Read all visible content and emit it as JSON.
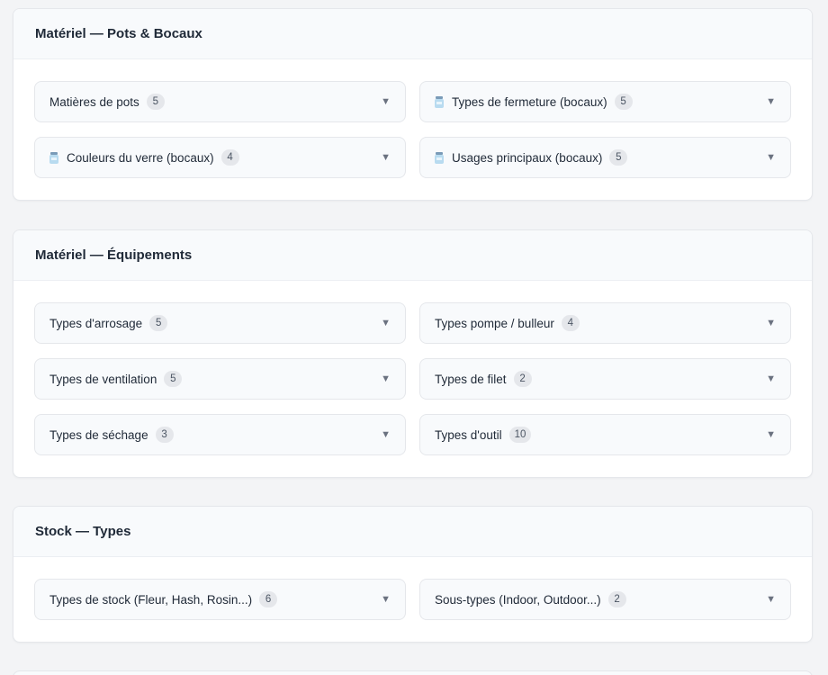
{
  "sections": [
    {
      "title": "Matériel — Pots & Bocaux",
      "items": [
        {
          "label": "Matières de pots",
          "count": "5",
          "icon": "jar-icon",
          "has_icon": false
        },
        {
          "label": "Types de fermeture (bocaux)",
          "count": "5",
          "icon": "jar-icon",
          "has_icon": true
        },
        {
          "label": "Couleurs du verre (bocaux)",
          "count": "4",
          "icon": "jar-icon",
          "has_icon": true
        },
        {
          "label": "Usages principaux (bocaux)",
          "count": "5",
          "icon": "jar-icon",
          "has_icon": true
        }
      ]
    },
    {
      "title": "Matériel — Équipements",
      "items": [
        {
          "label": "Types d'arrosage",
          "count": "5",
          "has_icon": false
        },
        {
          "label": "Types pompe / bulleur",
          "count": "4",
          "has_icon": false
        },
        {
          "label": "Types de ventilation",
          "count": "5",
          "has_icon": false
        },
        {
          "label": "Types de filet",
          "count": "2",
          "has_icon": false
        },
        {
          "label": "Types de séchage",
          "count": "3",
          "has_icon": false
        },
        {
          "label": "Types d'outil",
          "count": "10",
          "has_icon": false
        }
      ]
    },
    {
      "title": "Stock — Types",
      "items": [
        {
          "label": "Types de stock (Fleur, Hash, Rosin...)",
          "count": "6",
          "has_icon": false
        },
        {
          "label": "Sous-types (Indoor, Outdoor...)",
          "count": "2",
          "has_icon": false
        }
      ]
    }
  ],
  "caret_glyph": "▼",
  "colors": {
    "page_bg": "#f3f4f6",
    "card_header_bg": "#f8fafc",
    "badge_bg": "#e5e7eb",
    "jar_icon_body": "#b8dbf0"
  }
}
